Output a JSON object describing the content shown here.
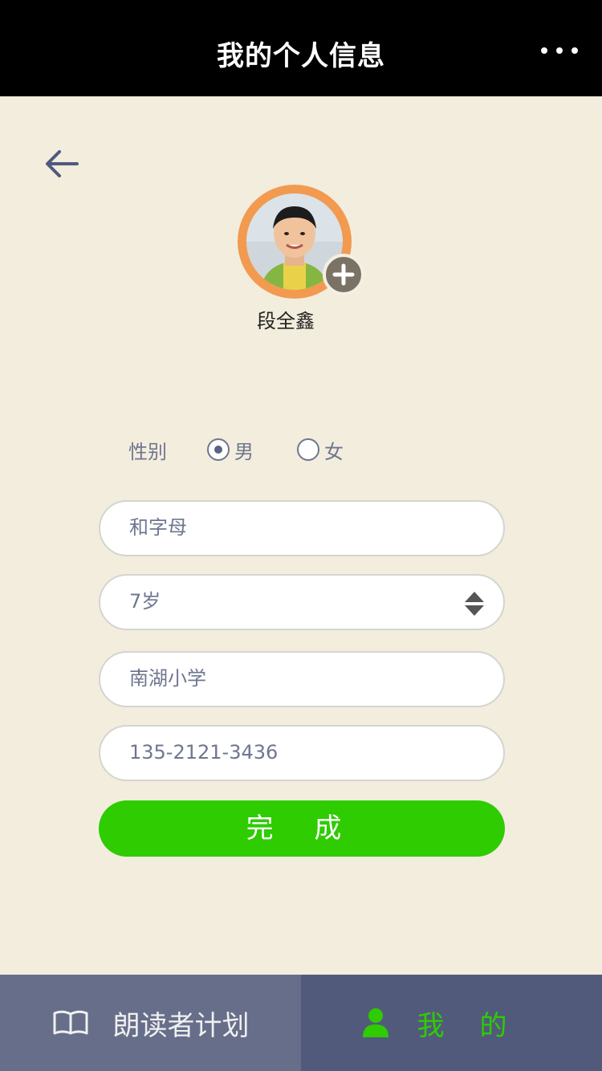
{
  "header": {
    "title": "我的个人信息"
  },
  "profile": {
    "name": "段全鑫"
  },
  "gender": {
    "label": "性别",
    "options": [
      "男",
      "女"
    ],
    "selected": "男"
  },
  "form": {
    "name_value": "和字母",
    "age_value": "7岁",
    "school_value": "南湖小学",
    "phone_value": "135-2121-3436"
  },
  "done_label": "完 成",
  "tabbar": {
    "plan_label": "朗读者计划",
    "me_label": "我的"
  },
  "colors": {
    "header_bg": "#000000",
    "page_bg": "#f3eddd",
    "accent_green": "#2ecc00",
    "tab_bg": "#666e8a",
    "tab_active_bg": "#525a7c",
    "avatar_ring": "#f29a50"
  },
  "icons": {
    "more": "more-icon",
    "back": "back-arrow-icon",
    "add_avatar": "plus-icon",
    "spinner": "spinner-icon",
    "book": "book-icon",
    "user": "user-icon"
  }
}
